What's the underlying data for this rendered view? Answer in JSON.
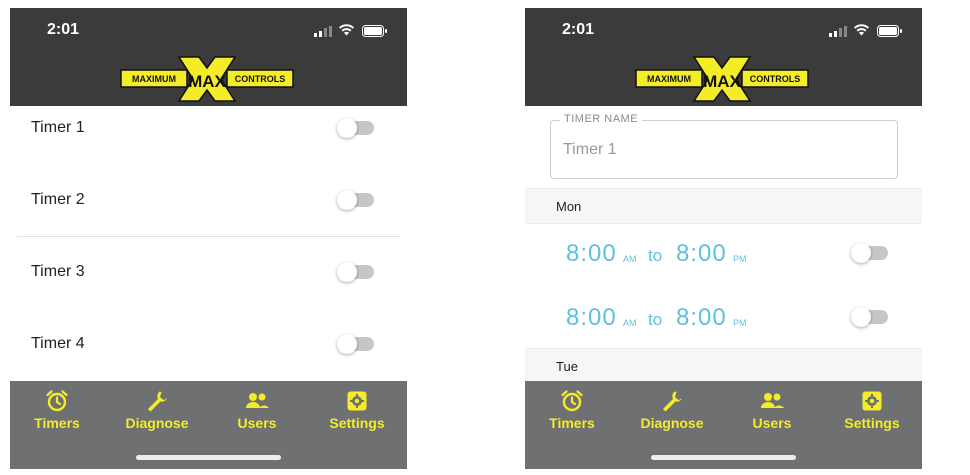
{
  "colors": {
    "header_bg": "#3b3b3b",
    "tabbar_bg": "#6f7072",
    "accent_yellow": "#f5ec29",
    "time_blue": "#5ec1dc"
  },
  "status_bar": {
    "time": "2:01"
  },
  "logo": {
    "left_text": "MAXIMUM",
    "center_text": "MAX",
    "right_text": "CONTROLS"
  },
  "timers_list": {
    "items": [
      {
        "label": "Timer 1",
        "enabled": false
      },
      {
        "label": "Timer 2",
        "enabled": false
      },
      {
        "label": "Timer 3",
        "enabled": false
      },
      {
        "label": "Timer 4",
        "enabled": false
      }
    ]
  },
  "timer_detail": {
    "name_field": {
      "label": "TIMER NAME",
      "placeholder": "Timer 1"
    },
    "days": [
      {
        "label": "Mon",
        "slots": [
          {
            "start_time": "8:00",
            "start_period": "AM",
            "separator": "to",
            "end_time": "8:00",
            "end_period": "PM",
            "enabled": false
          },
          {
            "start_time": "8:00",
            "start_period": "AM",
            "separator": "to",
            "end_time": "8:00",
            "end_period": "PM",
            "enabled": false
          }
        ]
      },
      {
        "label": "Tue"
      }
    ]
  },
  "tabbar": {
    "tabs": [
      {
        "label": "Timers",
        "icon": "alarm-clock-icon"
      },
      {
        "label": "Diagnose",
        "icon": "wrench-icon"
      },
      {
        "label": "Users",
        "icon": "users-icon"
      },
      {
        "label": "Settings",
        "icon": "gear-icon"
      }
    ]
  }
}
